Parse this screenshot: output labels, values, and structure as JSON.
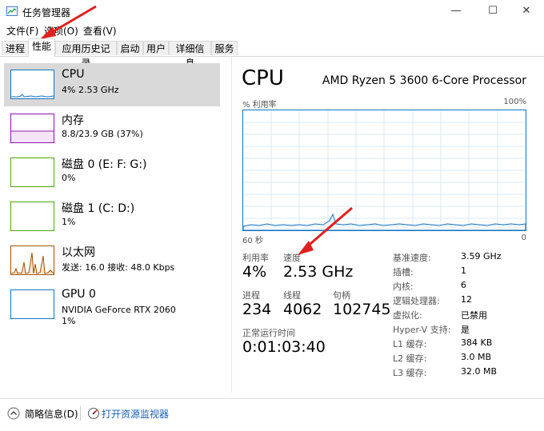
{
  "window": {
    "title": "任务管理器",
    "minimize_glyph": "—",
    "maximize_glyph": "☐",
    "close_glyph": "✕"
  },
  "menu": [
    "文件(F)",
    "选项(O)",
    "查看(V)"
  ],
  "tabs": [
    {
      "label": "进程"
    },
    {
      "label": "性能",
      "active": true
    },
    {
      "label": "应用历史记录"
    },
    {
      "label": "启动"
    },
    {
      "label": "用户"
    },
    {
      "label": "详细信息"
    },
    {
      "label": "服务"
    }
  ],
  "resources": [
    {
      "title": "CPU",
      "sub": "4% 2.53 GHz",
      "sub2": "",
      "color": "#1173c2",
      "selected": true
    },
    {
      "title": "内存",
      "sub": "8.8/23.9 GB (37%)",
      "sub2": "",
      "color": "#8b12ae"
    },
    {
      "title": "磁盘 0 (E: F: G:)",
      "sub": "0%",
      "sub2": "",
      "color": "#4da60c"
    },
    {
      "title": "磁盘 1 (C: D:)",
      "sub": "1%",
      "sub2": "",
      "color": "#4da60c"
    },
    {
      "title": "以太网",
      "sub": "发送: 16.0  接收: 48.0 Kbps",
      "sub2": "",
      "color": "#a74f01"
    },
    {
      "title": "GPU 0",
      "sub": "NVIDIA GeForce RTX 2060",
      "sub2": "1%",
      "color": "#1173c2"
    }
  ],
  "detail": {
    "title": "CPU",
    "processor": "AMD Ryzen 5 3600 6-Core Processor",
    "util_label": "% 利用率",
    "util_max": "100%",
    "time_left": "60 秒",
    "time_right": "0",
    "utilization_label": "利用率",
    "utilization_value": "4%",
    "speed_label": "速度",
    "speed_value": "2.53 GHz",
    "process_label": "进程",
    "process_value": "234",
    "thread_label": "线程",
    "thread_value": "4062",
    "handle_label": "句柄",
    "handle_value": "102745",
    "uptime_label": "正常运行时间",
    "uptime_value": "0:01:03:40",
    "specs": [
      {
        "key": "基准速度:",
        "val": "3.59 GHz"
      },
      {
        "key": "插槽:",
        "val": "1"
      },
      {
        "key": "内核:",
        "val": "6"
      },
      {
        "key": "逻辑处理器:",
        "val": "12"
      },
      {
        "key": "虚拟化:",
        "val": "已禁用"
      },
      {
        "key": "Hyper-V 支持:",
        "val": "是"
      },
      {
        "key": "L1 缓存:",
        "val": "384 KB"
      },
      {
        "key": "L2 缓存:",
        "val": "3.0 MB"
      },
      {
        "key": "L3 缓存:",
        "val": "32.0 MB"
      }
    ]
  },
  "footer": {
    "fewer_details": "简略信息(D)",
    "open_monitor": "打开资源监视器"
  },
  "accent": "#1173c2",
  "annotation_color": "#e0201e"
}
